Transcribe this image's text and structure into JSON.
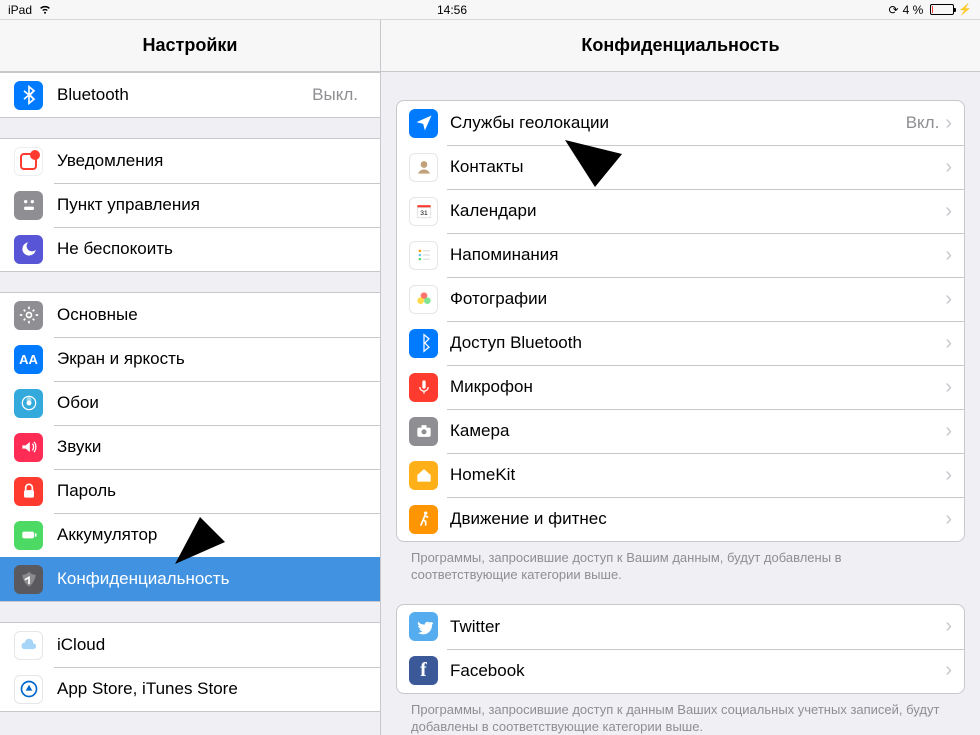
{
  "statusbar": {
    "device": "iPad",
    "time": "14:56",
    "batteryText": "4 %"
  },
  "sidebar": {
    "title": "Настройки",
    "bluetooth": {
      "label": "Bluetooth",
      "value": "Выкл."
    },
    "notifications": "Уведомления",
    "controlcenter": "Пункт управления",
    "dnd": "Не беспокоить",
    "general": "Основные",
    "display": "Экран и яркость",
    "wallpaper": "Обои",
    "sounds": "Звуки",
    "passcode": "Пароль",
    "battery": "Аккумулятор",
    "privacy": "Конфиденциальность",
    "icloud": "iCloud",
    "appstore": "App Store, iTunes Store"
  },
  "detail": {
    "title": "Конфиденциальность",
    "location": {
      "label": "Службы геолокации",
      "value": "Вкл."
    },
    "contacts": "Контакты",
    "calendars": "Календари",
    "reminders": "Напоминания",
    "photos": "Фотографии",
    "btaccess": "Доступ Bluetooth",
    "microphone": "Микрофон",
    "camera": "Камера",
    "homekit": "HomeKit",
    "motion": "Движение и фитнес",
    "footer1": "Программы, запросившие доступ к Вашим данным, будут добавлены в соответствующие категории выше.",
    "twitter": "Twitter",
    "facebook": "Facebook",
    "footer2": "Программы, запросившие доступ к данным Ваших социальных учетных записей, будут добавлены в соответствующие категории выше."
  }
}
